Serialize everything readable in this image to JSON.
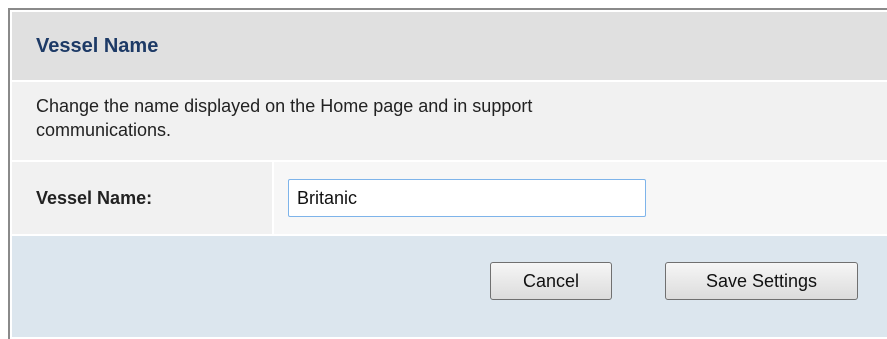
{
  "section": {
    "title": "Vessel Name",
    "description_line1": "Change the name displayed on the Home page and in support",
    "description_line2": "communications."
  },
  "form": {
    "vessel_name_label": "Vessel Name:",
    "vessel_name_value": "Britanic"
  },
  "actions": {
    "cancel_label": "Cancel",
    "save_label": "Save Settings"
  },
  "colors": {
    "title_text": "#1d3a66",
    "header_bg": "#e0e0e0",
    "actions_bg": "#dce6ee",
    "input_border": "#7eb4ea"
  }
}
